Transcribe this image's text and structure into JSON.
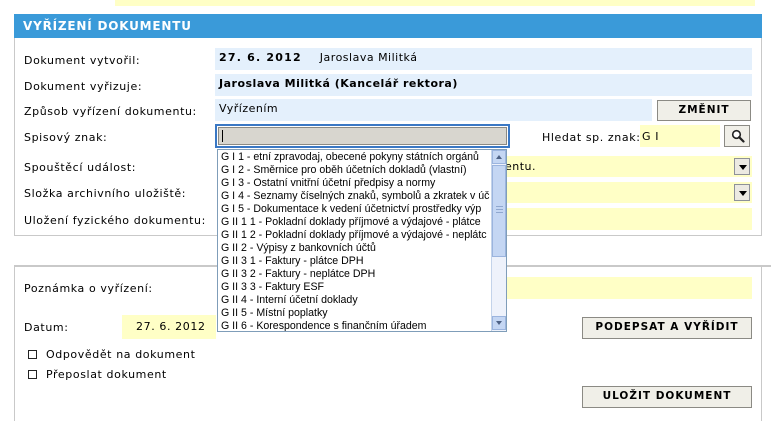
{
  "section": {
    "title": "VYŘÍZENÍ DOKUMENTU"
  },
  "fields": {
    "vytvoril": {
      "label": "Dokument vytvořil:",
      "date": "27. 6. 2012",
      "name": "Jaroslava Militká"
    },
    "vyrizuje": {
      "label": "Dokument vyřizuje:",
      "value": "Jaroslava Militká (Kancelář rektora)"
    },
    "zpusob": {
      "label": "Způsob vyřízení dokumentu:",
      "value": "Vyřízením",
      "button": "ZMĚNIT"
    },
    "spisovy": {
      "label": "Spisový znak:",
      "value": "",
      "search_label": "Hledat sp. znak:",
      "search_value": "G I"
    },
    "spoustec": {
      "label": "Spouštěcí událost:",
      "value_visible": "entu."
    },
    "slozka": {
      "label": "Složka archivního uložiště:"
    },
    "ulozeni": {
      "label": "Uložení fyzického dokumentu:"
    },
    "poznamka": {
      "label": "Poznámka o vyřízení:"
    },
    "datum": {
      "label": "Datum:",
      "value": "27. 6. 2012"
    }
  },
  "buttons": {
    "podepsat": "PODEPSAT A VYŘÍDIT",
    "ulozit": "ULOŽIT DOKUMENT"
  },
  "checkboxes": [
    {
      "label": "Odpovědět na dokument",
      "checked": false
    },
    {
      "label": "Přeposlat dokument",
      "checked": false
    }
  ],
  "dropdown": {
    "items": [
      "G I 1 - etní zpravodaj, obecené pokyny státních orgánů",
      "G I 2 - Směrnice pro oběh účetních dokladů (vlastní)",
      "G I 3 - Ostatní vnitřní účetní předpisy a normy",
      "G I 4 - Seznamy číselných znaků, symbolů a zkratek v úč",
      "G I 5 - Dokumentace k vedení účetnictví prostředky výp",
      "G II 1 1 - Pokladní doklady příjmové a výdajové - plátce",
      "G II 1 2 - Pokladní doklady příjmové a výdajové - neplátc",
      "G II 2 - Výpisy z bankovních účtů",
      "G II 3 1 - Faktury - plátce DPH",
      "G II 3 2 - Faktury - neplátce DPH",
      "G II 3 3 - Faktury ESF",
      "G II 4 - Interní účetní doklady",
      "G II 5 - Místní poplatky",
      "G II 6 - Korespondence s finančním úřadem"
    ]
  },
  "colors": {
    "header": "#3a9ad9",
    "field_blue": "#e4f0fc",
    "field_yellow": "#ffffc6",
    "border_blue": "#3a9ad9"
  }
}
